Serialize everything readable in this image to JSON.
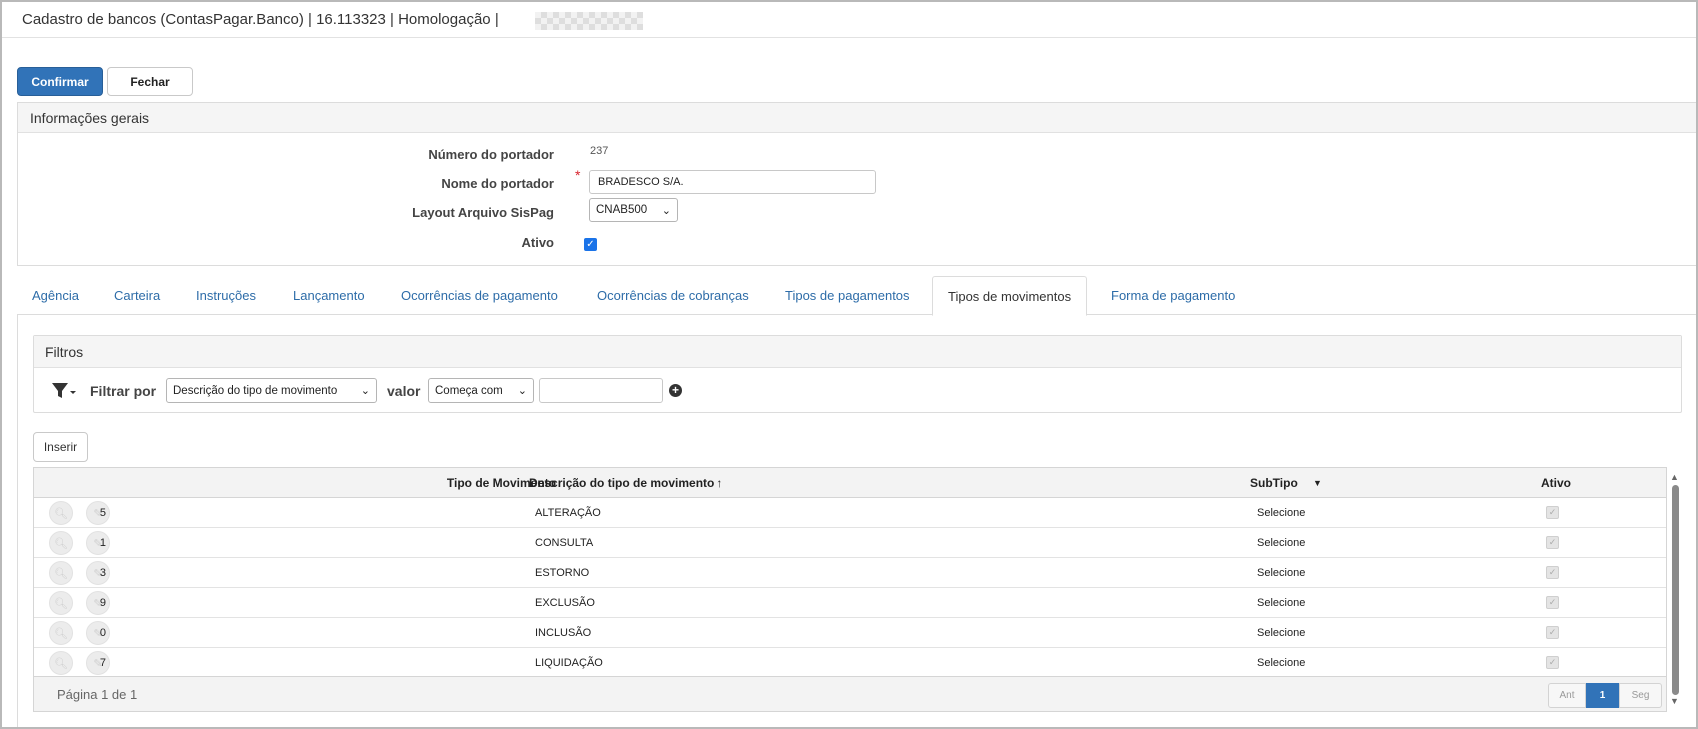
{
  "window": {
    "title": "Cadastro de bancos (ContasPagar.Banco) | 16.113323 | Homologação |"
  },
  "toolbar": {
    "confirm_label": "Confirmar",
    "close_label": "Fechar"
  },
  "general": {
    "header": "Informações gerais",
    "numero_label": "Número do portador",
    "numero_value": "237",
    "nome_label": "Nome do portador",
    "nome_value": "BRADESCO S/A.",
    "layout_label": "Layout Arquivo SisPag",
    "layout_value": "CNAB500",
    "ativo_label": "Ativo",
    "ativo_checked": true
  },
  "tabs": [
    {
      "label": "Agência"
    },
    {
      "label": "Carteira"
    },
    {
      "label": "Instruções"
    },
    {
      "label": "Lançamento"
    },
    {
      "label": "Ocorrências de pagamento"
    },
    {
      "label": "Ocorrências de cobranças"
    },
    {
      "label": "Tipos de pagamentos"
    },
    {
      "label": "Tipos de movimentos",
      "active": true
    },
    {
      "label": "Forma de pagamento"
    }
  ],
  "filters": {
    "header": "Filtros",
    "filter_by_label": "Filtrar por",
    "field_value": "Descrição do tipo de movimento",
    "valor_label": "valor",
    "operator_value": "Começa com",
    "text_value": ""
  },
  "grid": {
    "insert_label": "Inserir",
    "columns": [
      "Tipo de Movimento",
      "Descrição do tipo de movimento",
      "SubTipo",
      "Ativo"
    ],
    "sort_indicator": "↑",
    "rows": [
      {
        "tipo": "5",
        "descricao": "ALTERAÇÃO",
        "subtipo": "Selecione",
        "ativo": true
      },
      {
        "tipo": "1",
        "descricao": "CONSULTA",
        "subtipo": "Selecione",
        "ativo": true
      },
      {
        "tipo": "3",
        "descricao": "ESTORNO",
        "subtipo": "Selecione",
        "ativo": true
      },
      {
        "tipo": "9",
        "descricao": "EXCLUSÃO",
        "subtipo": "Selecione",
        "ativo": true
      },
      {
        "tipo": "0",
        "descricao": "INCLUSÃO",
        "subtipo": "Selecione",
        "ativo": true
      },
      {
        "tipo": "7",
        "descricao": "LIQUIDAÇÃO",
        "subtipo": "Selecione",
        "ativo": true
      }
    ],
    "page_text": "Página 1 de 1",
    "prev_label": "Ant",
    "current_page": "1",
    "next_label": "Seg"
  },
  "colors": {
    "primary": "#3173b8",
    "link": "#2d6ca8",
    "required": "#d9232d"
  }
}
